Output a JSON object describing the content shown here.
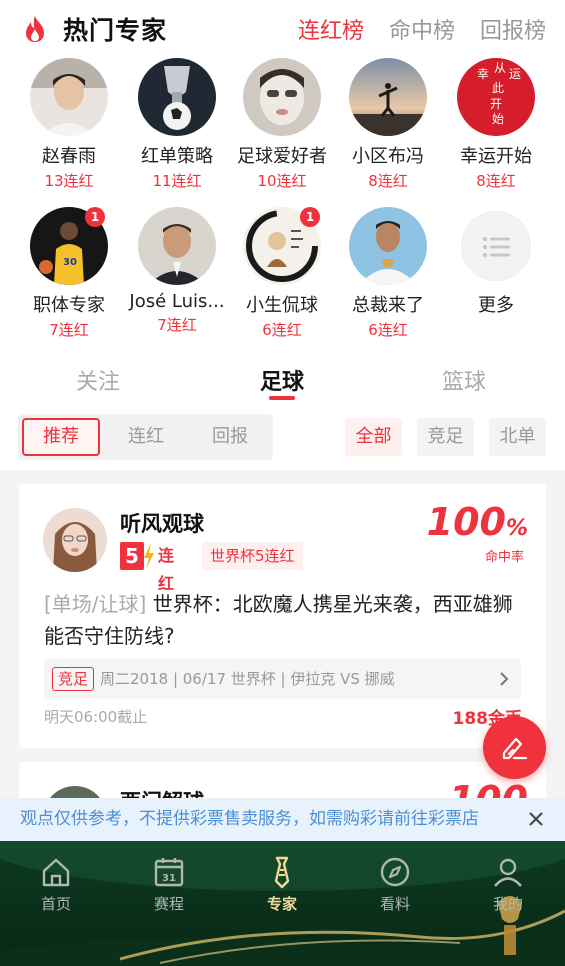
{
  "header": {
    "title": "热门专家",
    "rank_tabs": [
      "连红榜",
      "命中榜",
      "回报榜"
    ],
    "active_rank_tab": "连红榜"
  },
  "experts": [
    {
      "name": "赵春雨",
      "streak": "13连红"
    },
    {
      "name": "红单策略",
      "streak": "11连红"
    },
    {
      "name": "足球爱好者",
      "streak": "10连红"
    },
    {
      "name": "小区布冯",
      "streak": "8连红"
    },
    {
      "name": "幸运开始",
      "streak": "8连红",
      "avatar_text": [
        "幸",
        "从",
        "运",
        "此",
        "开",
        "始"
      ]
    },
    {
      "name": "职体专家",
      "streak": "7连红",
      "badge": "1"
    },
    {
      "name": "José Luis...",
      "streak": "7连红"
    },
    {
      "name": "小生侃球",
      "streak": "6连红",
      "badge": "1"
    },
    {
      "name": "总裁来了",
      "streak": "6连红"
    },
    {
      "name": "更多"
    }
  ],
  "sport_tabs": [
    "关注",
    "足球",
    "篮球"
  ],
  "active_sport_tab": "足球",
  "filters": {
    "segments": [
      "推荐",
      "连红",
      "回报"
    ],
    "active_segment": "推荐",
    "chips": [
      "全部",
      "竞足",
      "北单"
    ],
    "active_chip": "全部"
  },
  "cards": [
    {
      "author": "听风观球",
      "streak_num": "5",
      "streak_label": "连红",
      "tag": "世界杯5连红",
      "hit_rate": "100",
      "hit_rate_unit": "%",
      "hit_rate_label": "命中率",
      "title_tag": "[单场/让球]",
      "title": " 世界杯：北欧魔人携星光来袭，西亚雄狮能否守住防线?",
      "match_tag": "竞足",
      "match_info": "周二2018 | 06/17 世界杯 | 伊拉克 VS 挪威",
      "deadline": "明天06:00截止",
      "price": "188金币"
    },
    {
      "author": "西门解球",
      "hit_rate": "100"
    }
  ],
  "notice": "观点仅供参考，不提供彩票售卖服务，如需购彩请前往彩票店",
  "nav": {
    "items": [
      "首页",
      "赛程",
      "专家",
      "看料",
      "我的"
    ],
    "active": "专家",
    "calendar_day": "31"
  },
  "colors": {
    "accent": "#f0323c",
    "notice_text": "#4d8fd3",
    "nav_bg": "#0d3a22",
    "nav_active": "#f1d99a"
  }
}
